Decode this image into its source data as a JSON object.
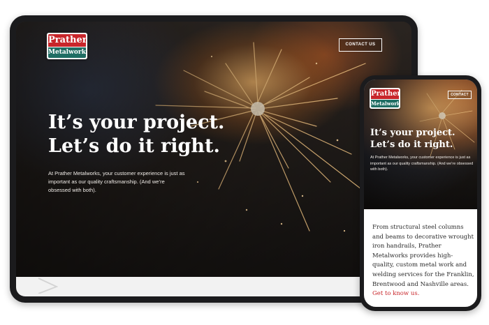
{
  "brand": {
    "name_top": "Prather",
    "name_bottom": "Metalworks",
    "red": "#c8262b",
    "teal": "#1f6d63"
  },
  "header": {
    "contact_label": "CONTACT US",
    "contact_label_phone": "CONTACT"
  },
  "hero": {
    "headline_line1": "It’s your project.",
    "headline_line2": "Let’s do it right.",
    "intro": "At Prather Metalworks, your customer experience is just as important as our quality craftsmanship. (And we’re obsessed with both)."
  },
  "about": {
    "body": "From structural steel columns and beams to decorative wrought iron handrails, Prather Metalworks provides high-quality, custom metal work and welding services for the Franklin, Brentwood and Nashville areas.",
    "link_label": "Get to know us."
  }
}
